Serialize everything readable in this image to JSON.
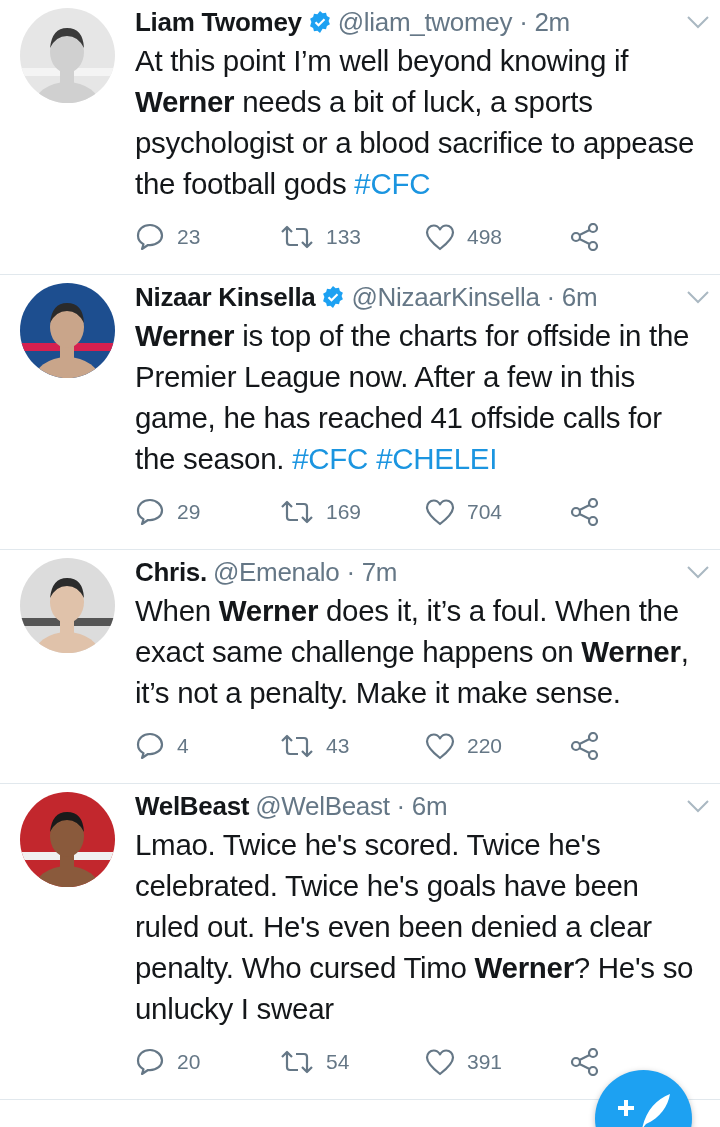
{
  "tweets": [
    {
      "name": "Liam Twomey",
      "verified": true,
      "meta": "@liam_twomey · 2m",
      "avatar": {
        "kind": "picture"
      },
      "text": [
        {
          "kind": "plain",
          "text": "At this point I’m well beyond knowing if "
        },
        {
          "kind": "bold",
          "text": "Werner"
        },
        {
          "kind": "plain",
          "text": " needs a bit of luck, a sports psychologist or a blood sacrifice to appease the football gods "
        },
        {
          "kind": "hashtag",
          "text": "#CFC"
        }
      ],
      "replies": "23",
      "retweets": "133",
      "likes": "498"
    },
    {
      "name": "Nizaar Kinsella",
      "verified": true,
      "meta": "@NizaarKinsella · 6m",
      "avatar": {
        "kind": "picture"
      },
      "text": [
        {
          "kind": "bold",
          "text": "Werner"
        },
        {
          "kind": "plain",
          "text": " is top of the charts for offside in the Premier League now. After a few in this game, he has reached 41 offside calls for the season. "
        },
        {
          "kind": "hashtag",
          "text": "#CFC"
        },
        {
          "kind": "hashtag",
          "text": "#CHELEI"
        }
      ],
      "replies": "29",
      "retweets": "169",
      "likes": "704"
    },
    {
      "name": "Chris.",
      "verified": false,
      "meta": "@Emenalo · 7m",
      "avatar": {
        "kind": "picture"
      },
      "text": [
        {
          "kind": "plain",
          "text": "When "
        },
        {
          "kind": "bold",
          "text": "Werner"
        },
        {
          "kind": "plain",
          "text": " does it, it’s a foul. When the exact same challenge happens on "
        },
        {
          "kind": "bold",
          "text": "Werner"
        },
        {
          "kind": "plain",
          "text": ", it’s not a penalty. Make it make sense."
        }
      ],
      "replies": "4",
      "retweets": "43",
      "likes": "220"
    },
    {
      "name": "WelBeast",
      "verified": false,
      "meta": "@WelBeast · 6m",
      "avatar": {
        "kind": "picture"
      },
      "text": [
        {
          "kind": "plain",
          "text": "Lmao. Twice he's scored. Twice he's celebrated. Twice he's goals have been ruled out. He's even been denied a clear penalty. Who cursed Timo "
        },
        {
          "kind": "bold",
          "text": "Werner"
        },
        {
          "kind": "plain",
          "text": "? He's so unlucky I swear"
        }
      ],
      "replies": "20",
      "retweets": "54",
      "likes": "391"
    }
  ]
}
